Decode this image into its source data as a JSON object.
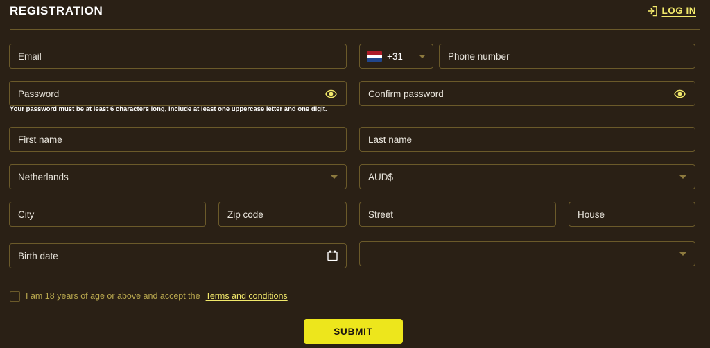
{
  "header": {
    "title": "REGISTRATION",
    "login_label": "LOG IN",
    "login_icon": "login-arrow-icon"
  },
  "theme": {
    "background": "#2a2015",
    "border": "#6b5a2a",
    "accent_yellow": "#f2e96b",
    "submit_bg": "#ede61c",
    "text": "#e8e4dc",
    "consent_text": "#b9a84e"
  },
  "form": {
    "email": {
      "placeholder": "Email",
      "value": ""
    },
    "phone_country": {
      "dial_code": "+31",
      "flag": "netherlands-flag",
      "caret": "chevron-down-icon"
    },
    "phone": {
      "placeholder": "Phone number",
      "value": ""
    },
    "password": {
      "placeholder": "Password",
      "value": "",
      "toggle_icon": "eye-icon"
    },
    "password_helper": "Your password must be at least 6 characters long, include at least one uppercase letter and one digit.",
    "confirm_password": {
      "placeholder": "Confirm password",
      "value": "",
      "toggle_icon": "eye-icon"
    },
    "first_name": {
      "placeholder": "First name",
      "value": ""
    },
    "last_name": {
      "placeholder": "Last name",
      "value": ""
    },
    "country": {
      "value": "Netherlands",
      "caret": "chevron-down-icon"
    },
    "currency": {
      "value": "AUD$",
      "caret": "chevron-down-icon"
    },
    "city": {
      "placeholder": "City",
      "value": ""
    },
    "zip_code": {
      "placeholder": "Zip code",
      "value": ""
    },
    "street": {
      "placeholder": "Street",
      "value": ""
    },
    "house": {
      "placeholder": "House",
      "value": ""
    },
    "birth_date": {
      "placeholder": "Birth date",
      "value": "",
      "icon": "calendar-icon"
    },
    "extra_select": {
      "value": "",
      "caret": "chevron-down-icon"
    }
  },
  "consent": {
    "checked": false,
    "text": "I am 18 years of age or above and accept the",
    "terms_link": "Terms and conditions"
  },
  "submit": {
    "label": "SUBMIT"
  }
}
